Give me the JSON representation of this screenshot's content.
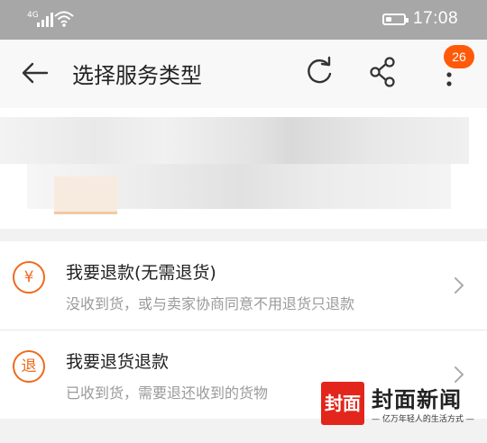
{
  "status_bar": {
    "network_label": "4G",
    "time": "17:08",
    "battery_level": 0.35
  },
  "app_bar": {
    "title": "选择服务类型",
    "notification_count": "26",
    "icons": [
      "back-arrow-icon",
      "refresh-icon",
      "share-icon",
      "more-vertical-icon"
    ]
  },
  "service_options": [
    {
      "title": "我要退款(无需退货)",
      "description": "没收到货，或与卖家协商同意不用退货只退款",
      "icon_glyph": "¥",
      "icon_name": "refund-yuan-icon"
    },
    {
      "title": "我要退货退款",
      "description": "已收到货，需要退还收到的货物",
      "icon_glyph": "退",
      "icon_name": "return-icon"
    }
  ],
  "watermark": {
    "seal": "封面",
    "name": "封面新闻",
    "slogan": "— 亿万年轻人的生活方式 —"
  },
  "colors": {
    "accent": "#ef6a1c",
    "badge": "#ff5a0a",
    "status_bar": "#a7a7a7",
    "watermark_red": "#e2261b"
  }
}
